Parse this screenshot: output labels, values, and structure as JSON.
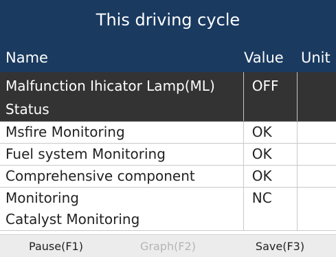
{
  "header": {
    "title": "This driving cycle"
  },
  "columns": {
    "name": "Name",
    "value": "Value",
    "unit": "Unit"
  },
  "rows": [
    {
      "name_line1": "Malfunction Ihicator Lamp(ML)",
      "name_line2": "Status",
      "value": "OFF",
      "unit": ""
    },
    {
      "name": "Msfire Monitoring",
      "value": "OK",
      "unit": ""
    },
    {
      "name": "Fuel system Monitoring",
      "value": "OK",
      "unit": ""
    },
    {
      "name": "Comprehensive component",
      "value": "OK",
      "unit": ""
    },
    {
      "name_line1": "Monitoring",
      "name_line2": "Catalyst Monitoring",
      "value": "NC",
      "unit": ""
    }
  ],
  "footer": {
    "pause": "Pause(F1)",
    "graph": "Graph(F2)",
    "save": "Save(F3)"
  },
  "colors": {
    "header_bg": "#1a3a60",
    "selected_row_bg": "#333333",
    "footer_bg": "#ececec"
  }
}
